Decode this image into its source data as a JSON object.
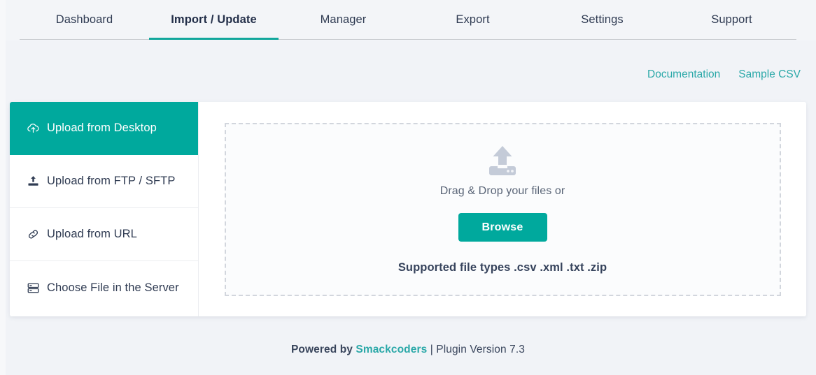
{
  "nav": {
    "tabs": [
      {
        "label": "Dashboard",
        "active": false
      },
      {
        "label": "Import / Update",
        "active": true
      },
      {
        "label": "Manager",
        "active": false
      },
      {
        "label": "Export",
        "active": false
      },
      {
        "label": "Settings",
        "active": false
      },
      {
        "label": "Support",
        "active": false
      }
    ]
  },
  "top_links": [
    {
      "label": "Documentation"
    },
    {
      "label": "Sample CSV"
    }
  ],
  "sidebar": {
    "items": [
      {
        "label": "Upload from Desktop",
        "icon": "cloud-upload-icon",
        "active": true
      },
      {
        "label": "Upload from FTP / SFTP",
        "icon": "upload-tray-icon",
        "active": false
      },
      {
        "label": "Upload from URL",
        "icon": "link-icon",
        "active": false
      },
      {
        "label": "Choose File in the Server",
        "icon": "server-icon",
        "active": false
      }
    ]
  },
  "dropzone": {
    "icon": "upload-cloud-art-icon",
    "drag_text": "Drag & Drop your files or",
    "browse_label": "Browse",
    "supported_text": "Supported file types .csv .xml .txt .zip"
  },
  "footer": {
    "prefix": "Powered by ",
    "brand": "Smackcoders",
    "suffix": " | Plugin Version 7.3"
  },
  "colors": {
    "accent_teal": "#00a99d",
    "link_teal": "#2aa8a8",
    "page_bg": "#f1f3f7",
    "text_dark": "#2f3b52",
    "dash_border": "#d2d6dd"
  }
}
